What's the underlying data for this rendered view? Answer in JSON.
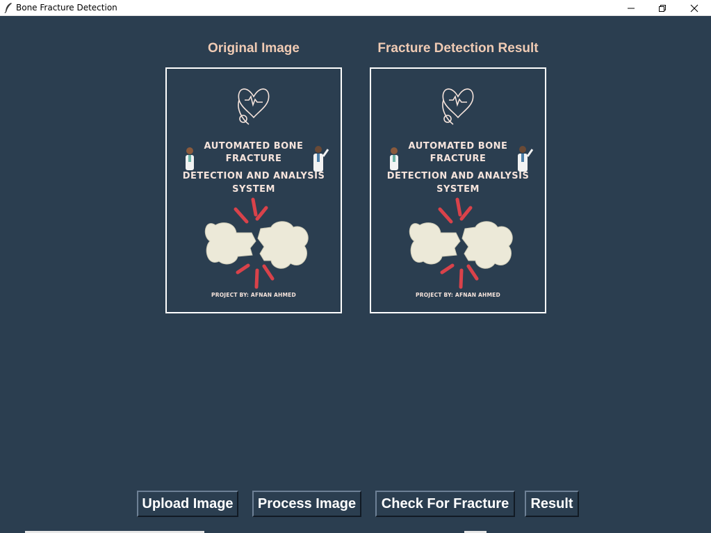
{
  "window": {
    "title": "Bone Fracture Detection",
    "icon": "feather-icon"
  },
  "panels": {
    "original_title": "Original Image",
    "result_title": "Fracture Detection Result"
  },
  "poster": {
    "heading_line1": "AUTOMATED BONE",
    "heading_line2": "FRACTURE",
    "heading_line3": "DETECTION AND ANALYSIS",
    "heading_line4": "SYSTEM",
    "footer": "PROJECT BY: AFNAN AHMED"
  },
  "buttons": {
    "upload": "Upload Image",
    "process": "Process Image",
    "check": "Check For Fracture",
    "result": "Result"
  },
  "colors": {
    "background": "#2b3e50",
    "title_text": "#f0cbb4",
    "button_text": "#ffffff",
    "crack_red": "#d9424a",
    "bone": "#ece9d8"
  }
}
